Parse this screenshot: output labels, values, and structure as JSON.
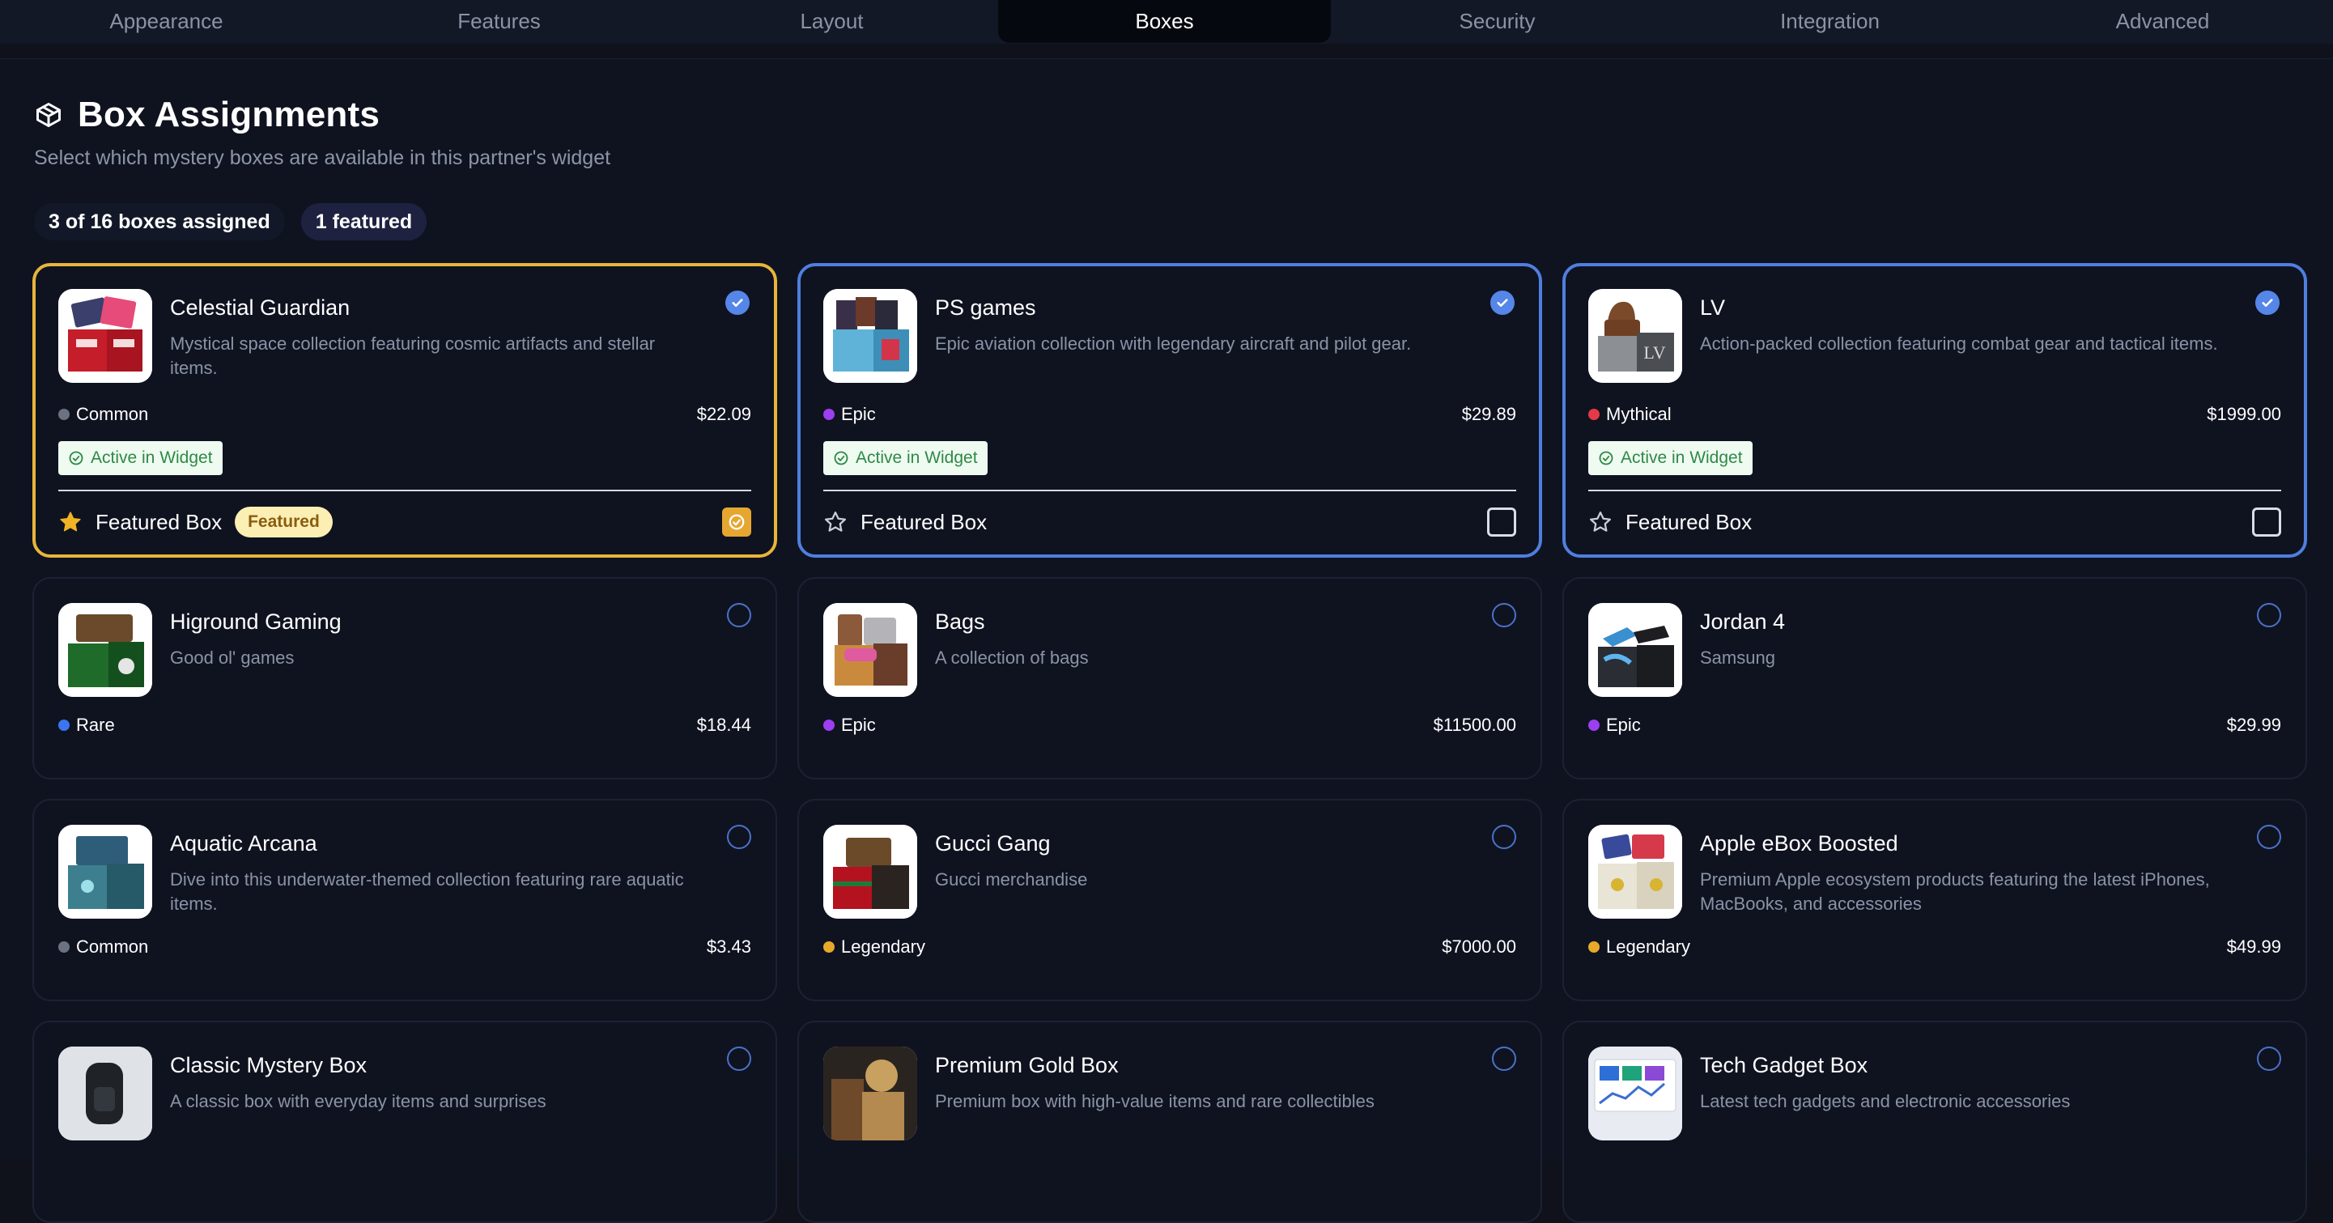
{
  "tabs": [
    {
      "label": "Appearance"
    },
    {
      "label": "Features"
    },
    {
      "label": "Layout"
    },
    {
      "label": "Boxes"
    },
    {
      "label": "Security"
    },
    {
      "label": "Integration"
    },
    {
      "label": "Advanced"
    }
  ],
  "active_tab": "Boxes",
  "header": {
    "title": "Box Assignments",
    "subtitle": "Select which mystery boxes are available in this partner's widget"
  },
  "stats": {
    "assigned": "3 of 16 boxes assigned",
    "featured": "1 featured"
  },
  "labels": {
    "active_in_widget": "Active in Widget",
    "featured_box": "Featured Box",
    "featured_badge": "Featured"
  },
  "colors": {
    "selected_border": "#4f7fdf",
    "featured_border": "#e9b53a",
    "common": "#6b7280",
    "epic": "#9b3ff0",
    "mythical": "#e53945",
    "rare": "#3b76f0",
    "legendary": "#e8a92a"
  },
  "boxes": [
    {
      "name": "Celestial Guardian",
      "desc": "Mystical space collection featuring cosmic artifacts and stellar items.",
      "rarity": "Common",
      "price": "$22.09",
      "selected": true,
      "featured": true
    },
    {
      "name": "PS games",
      "desc": "Epic aviation collection with legendary aircraft and pilot gear.",
      "rarity": "Epic",
      "price": "$29.89",
      "selected": true,
      "featured": false
    },
    {
      "name": "LV",
      "desc": "Action-packed collection featuring combat gear and tactical items.",
      "rarity": "Mythical",
      "price": "$1999.00",
      "selected": true,
      "featured": false
    },
    {
      "name": "Higround Gaming",
      "desc": "Good ol' games",
      "rarity": "Rare",
      "price": "$18.44",
      "selected": false
    },
    {
      "name": "Bags",
      "desc": "A collection of bags",
      "rarity": "Epic",
      "price": "$11500.00",
      "selected": false
    },
    {
      "name": "Jordan 4",
      "desc": "Samsung",
      "rarity": "Epic",
      "price": "$29.99",
      "selected": false
    },
    {
      "name": "Aquatic Arcana",
      "desc": "Dive into this underwater-themed collection featuring rare aquatic items.",
      "rarity": "Common",
      "price": "$3.43",
      "selected": false
    },
    {
      "name": "Gucci Gang",
      "desc": "Gucci merchandise",
      "rarity": "Legendary",
      "price": "$7000.00",
      "selected": false
    },
    {
      "name": "Apple eBox Boosted",
      "desc": "Premium Apple ecosystem products featuring the latest iPhones, MacBooks, and accessories",
      "rarity": "Legendary",
      "price": "$49.99",
      "selected": false
    },
    {
      "name": "Classic Mystery Box",
      "desc": "A classic box with everyday items and surprises",
      "rarity": "",
      "price": "",
      "selected": false
    },
    {
      "name": "Premium Gold Box",
      "desc": "Premium box with high-value items and rare collectibles",
      "rarity": "",
      "price": "",
      "selected": false
    },
    {
      "name": "Tech Gadget Box",
      "desc": "Latest tech gadgets and electronic accessories",
      "rarity": "",
      "price": "",
      "selected": false
    }
  ]
}
